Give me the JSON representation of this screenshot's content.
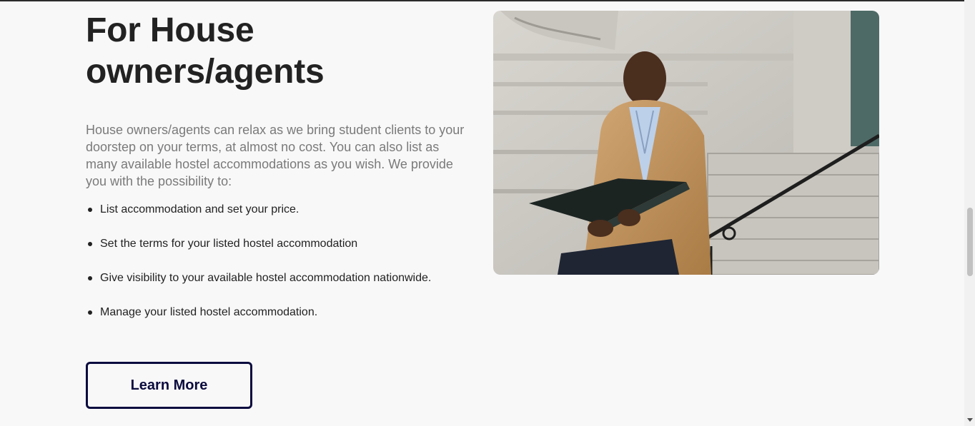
{
  "section": {
    "title_line1": "For House",
    "title_line2": "owners/agents",
    "intro": "House owners/agents can relax as we bring student clients to your doorstep on your terms, at almost no cost. You can also list as many available hostel accommodations as you wish. We provide you with the possibility to:",
    "features": [
      "List accommodation and set your price.",
      "Set the terms for your listed hostel accommodation",
      "Give visibility to your available hostel accommodation nationwide.",
      "Manage your listed hostel accommodation."
    ],
    "cta_label": "Learn More"
  },
  "image": {
    "alt": "Man in a camel coat sitting on stone steps reading a folder"
  },
  "colors": {
    "background": "#f8f8f9",
    "heading": "#222222",
    "body_text": "#7a7a7a",
    "button_border": "#0c0c3f"
  }
}
